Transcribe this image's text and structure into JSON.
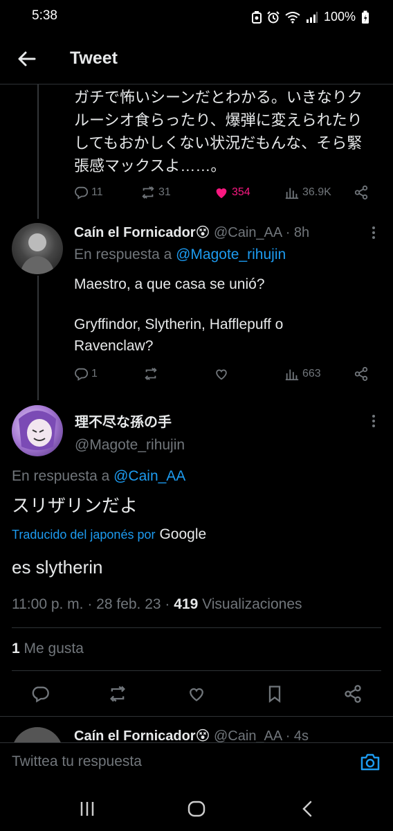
{
  "status_bar": {
    "time": "5:38",
    "battery": "100%"
  },
  "header": {
    "title": "Tweet"
  },
  "prev_tweet": {
    "text_lines": [
      "ガチで怖いシーンだとわかる。いきなりク",
      "ルーシオ食らったり、爆弾に変えられたり",
      "してもおかしくない状況だもんな、そら緊",
      "張感マックスよ……。"
    ],
    "replies": "11",
    "retweets": "31",
    "likes": "354",
    "views": "36.9K"
  },
  "reply_tweet": {
    "name": "Caín el Fornicador😵",
    "handle": "@Cain_AA",
    "time": "· 8h",
    "in_reply_prefix": "En respuesta a",
    "in_reply_handle": "@Magote_rihujin",
    "text_line1": "Maestro, a que casa se unió?",
    "text_line2": "Gryffindor, Slytherin, Hafflepuff o",
    "text_line3": "Ravenclaw?",
    "replies": "1",
    "views": "663"
  },
  "main_tweet": {
    "name": "理不尽な孫の手",
    "handle": "@Magote_rihujin",
    "in_reply_prefix": "En respuesta a",
    "in_reply_handle": "@Cain_AA",
    "text": "スリザリンだよ",
    "translated_by": "Traducido del japonés por",
    "translator": "Google",
    "translation": "es slytherin",
    "timestamp": "11:00 p. m. · 28 feb. 23 · ",
    "views_count": "419",
    "views_label": " Visualizaciones",
    "likes_count": "1",
    "likes_label": " Me gusta"
  },
  "next_tweet_peek": {
    "name": "Caín el Fornicador😵",
    "handle": "@Cain_AA · 4s"
  },
  "reply_bar": {
    "placeholder": "Twittea tu respuesta"
  },
  "colors": {
    "accent": "#1d9bf0",
    "like": "#f91880",
    "muted": "#71767b",
    "background": "#000000"
  }
}
